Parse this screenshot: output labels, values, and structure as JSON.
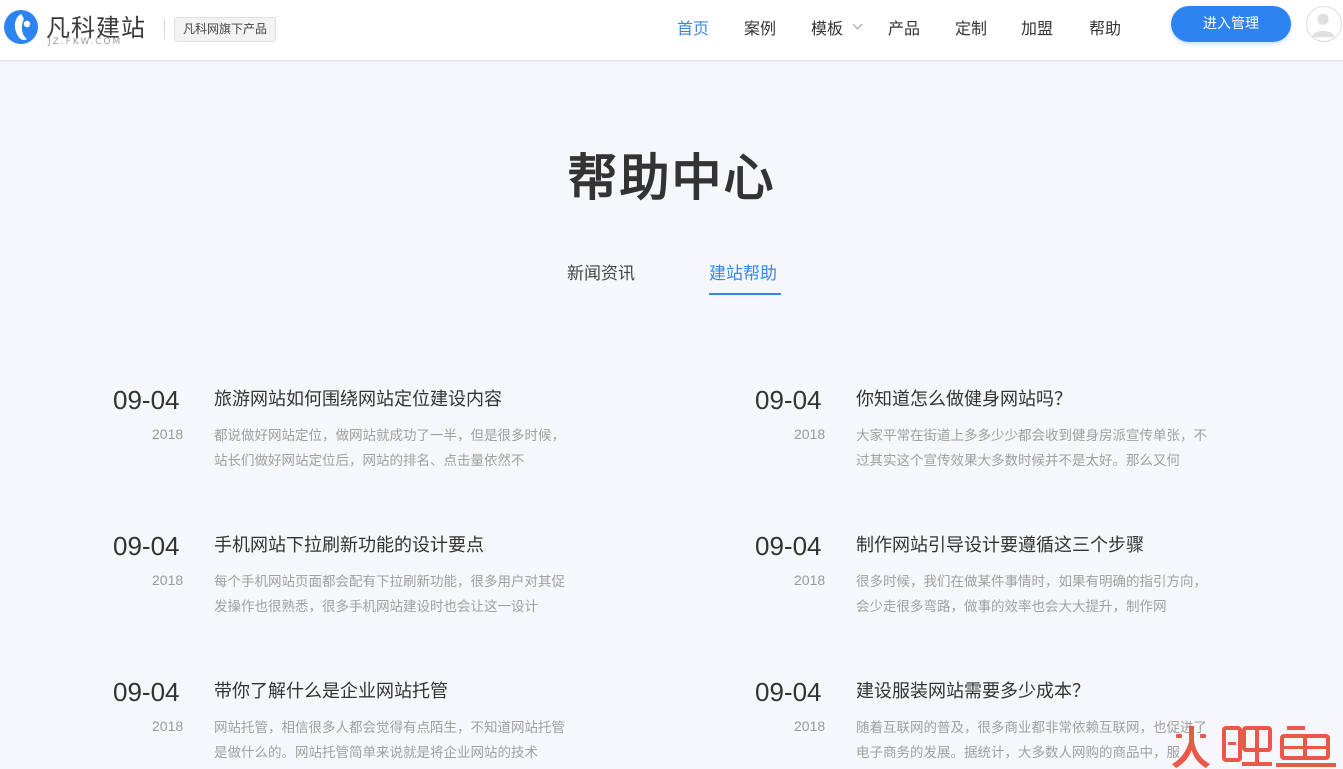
{
  "header": {
    "logo_text": "凡科建站",
    "logo_sub": "JZ.FKW.COM",
    "product_tag": "凡科网旗下产品",
    "nav": [
      {
        "label": "首页",
        "active": true
      },
      {
        "label": "案例",
        "active": false
      },
      {
        "label": "模板",
        "active": false,
        "has_dropdown": true
      },
      {
        "label": "产品",
        "active": false
      },
      {
        "label": "定制",
        "active": false
      },
      {
        "label": "加盟",
        "active": false
      },
      {
        "label": "帮助",
        "active": false
      }
    ],
    "manage_button": "进入管理",
    "accent_color": "#2d84f1"
  },
  "page": {
    "title": "帮助中心",
    "tabs": [
      {
        "label": "新闻资讯",
        "active": false
      },
      {
        "label": "建站帮助",
        "active": true
      }
    ]
  },
  "articles": [
    {
      "day": "09-04",
      "year": "2018",
      "title": "旅游网站如何围绕网站定位建设内容",
      "summary": "都说做好网站定位，做网站就成功了一半，但是很多时候，站长们做好网站定位后，网站的排名、点击量依然不"
    },
    {
      "day": "09-04",
      "year": "2018",
      "title": "你知道怎么做健身网站吗？",
      "summary": "大家平常在街道上多多少少都会收到健身房派宣传单张，不过其实这个宣传效果大多数时候并不是太好。那么又何"
    },
    {
      "day": "09-04",
      "year": "2018",
      "title": "手机网站下拉刷新功能的设计要点",
      "summary": "每个手机网站页面都会配有下拉刷新功能，很多用户对其促发操作也很熟悉，很多手机网站建设时也会让这一设计"
    },
    {
      "day": "09-04",
      "year": "2018",
      "title": "制作网站引导设计要遵循这三个步骤",
      "summary": "很多时候，我们在做某件事情时，如果有明确的指引方向，会少走很多弯路，做事的效率也会大大提升，制作网"
    },
    {
      "day": "09-04",
      "year": "2018",
      "title": "带你了解什么是企业网站托管",
      "summary": "网站托管，相信很多人都会觉得有点陌生，不知道网站托管是做什么的。网站托管简单来说就是将企业网站的技术"
    },
    {
      "day": "09-04",
      "year": "2018",
      "title": "建设服装网站需要多少成本？",
      "summary": "随着互联网的普及，很多商业都非常依赖互联网，也促进了电子商务的发展。据统计，大多数人网购的商品中，服"
    }
  ],
  "watermark": "火鲤鱼"
}
